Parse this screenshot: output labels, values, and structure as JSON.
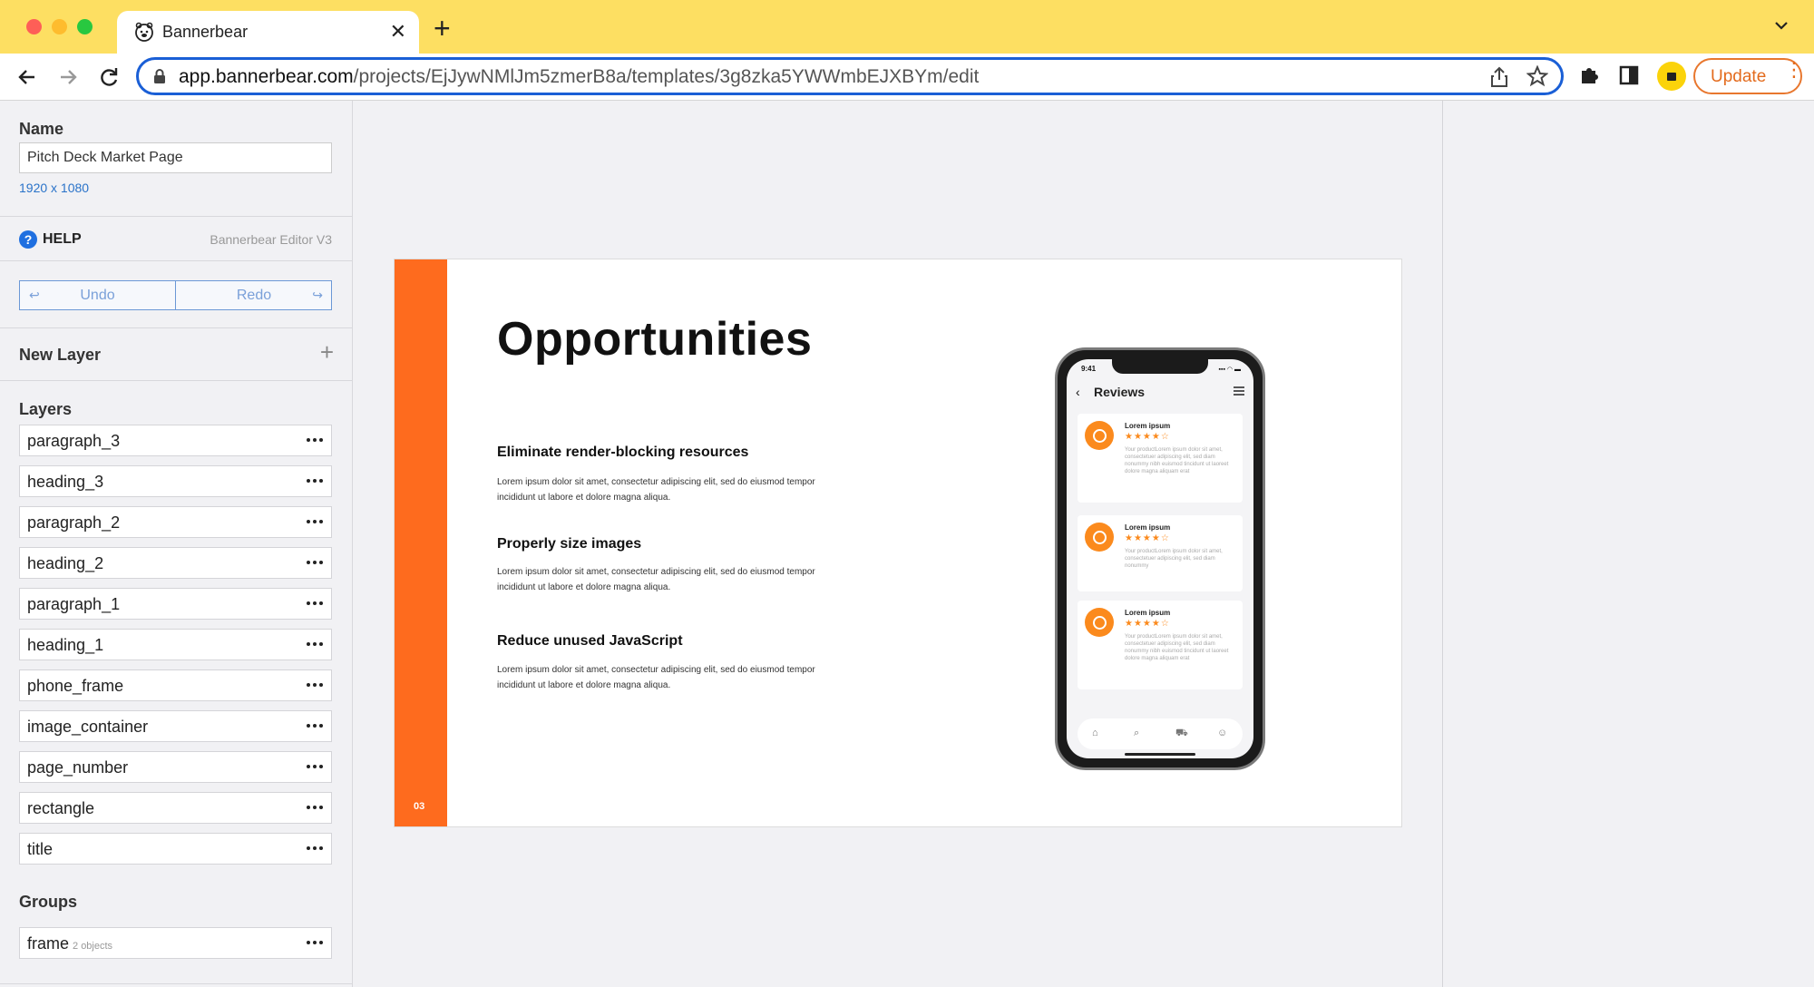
{
  "browser": {
    "tab_title": "Bannerbear",
    "new_tab": "+",
    "tab_close": "✕",
    "url_domain": "app.bannerbear.com",
    "url_path": "/projects/EjJywNMlJm5zmerB8a/templates/3g8zka5YWWmbEJXBYm/edit",
    "update_label": "Update",
    "update_menu": "⋮"
  },
  "sidebar": {
    "name_label": "Name",
    "name_value": "Pitch Deck Market Page",
    "dimensions": "1920 x 1080",
    "help_label": "HELP",
    "help_icon": "?",
    "editor_version": "Bannerbear Editor V3",
    "undo_label": "Undo",
    "redo_label": "Redo",
    "undo_icon": "↩",
    "redo_icon": "↪",
    "new_layer_label": "New Layer",
    "new_layer_icon": "+",
    "layers_label": "Layers",
    "layers": [
      {
        "name": "paragraph_3"
      },
      {
        "name": "heading_3"
      },
      {
        "name": "paragraph_2"
      },
      {
        "name": "heading_2"
      },
      {
        "name": "paragraph_1"
      },
      {
        "name": "heading_1"
      },
      {
        "name": "phone_frame"
      },
      {
        "name": "image_container"
      },
      {
        "name": "page_number"
      },
      {
        "name": "rectangle"
      },
      {
        "name": "title"
      }
    ],
    "groups_label": "Groups",
    "groups": [
      {
        "name": "frame",
        "count": "2 objects"
      }
    ]
  },
  "slide": {
    "title": "Opportunities",
    "page_number": "03",
    "accent_color": "#fe6b1e",
    "items": [
      {
        "heading": "Eliminate render-blocking resources",
        "text": "Lorem ipsum dolor sit amet, consectetur adipiscing elit, sed do eiusmod tempor incididunt ut labore et dolore magna aliqua."
      },
      {
        "heading": "Properly size images",
        "text": "Lorem ipsum dolor sit amet, consectetur adipiscing elit, sed do eiusmod tempor incididunt ut labore et dolore magna aliqua."
      },
      {
        "heading": "Reduce unused JavaScript",
        "text": "Lorem ipsum dolor sit amet, consectetur adipiscing elit, sed do eiusmod tempor incididunt ut labore et dolore magna aliqua."
      }
    ],
    "phone": {
      "time": "9:41",
      "status_icons": "▪▪▪ ◠ ▬",
      "back_icon": "‹",
      "screen_title": "Reviews",
      "reviews": [
        {
          "name": "Lorem ipsum",
          "stars": "★★★★☆",
          "text": "Your productLorem ipsum dolor sit amet, consectetuer adipiscing elit, sed diam nonummy nibh euismod tincidunt ut laoreet dolore magna aliquam erat"
        },
        {
          "name": "Lorem ipsum",
          "stars": "★★★★☆",
          "text": "Your productLorem ipsum dolor sit amet, consectetuer adipiscing elit, sed diam nonummy"
        },
        {
          "name": "Lorem ipsum",
          "stars": "★★★★☆",
          "text": "Your productLorem ipsum dolor sit amet, consectetuer adipiscing elit, sed diam nonummy nibh euismod tincidunt ut laoreet dolore magna aliquam erat"
        }
      ],
      "nav_icons": [
        "⌂",
        "⌕",
        "⛟",
        "☺"
      ],
      "review_accent": "#fb8a1d"
    }
  }
}
